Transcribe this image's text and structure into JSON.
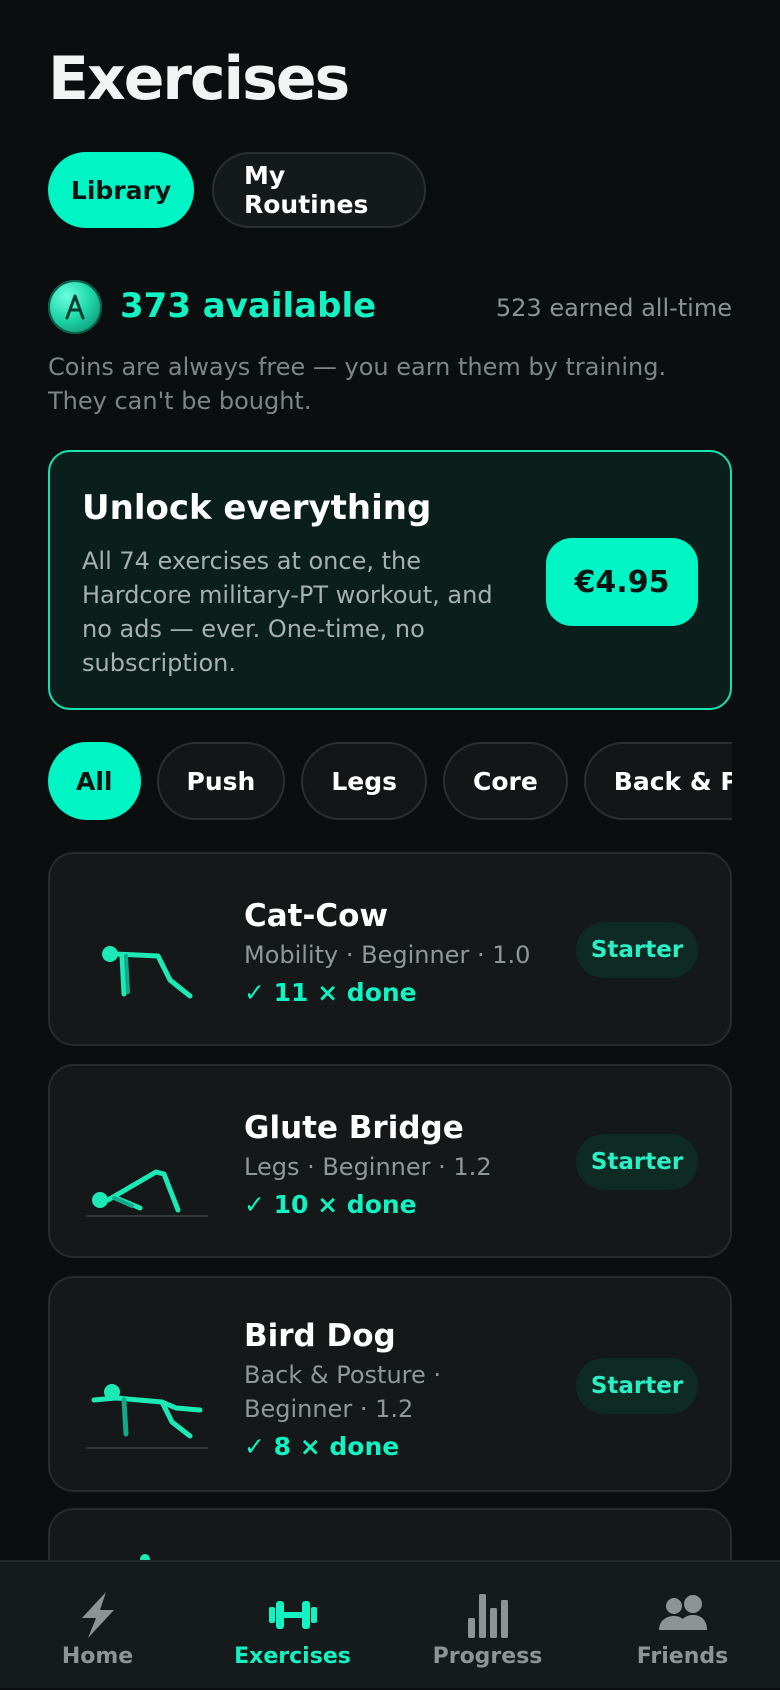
{
  "header": {
    "title": "Exercises"
  },
  "segments": {
    "library": "Library",
    "routines": "My Routines"
  },
  "coins": {
    "available": "373 available",
    "earned": "523 earned all-time",
    "note": "Coins are always free — you earn them by training. They can't be bought."
  },
  "unlock": {
    "title": "Unlock everything",
    "description": "All 74 exercises at once, the Hardcore military-PT workout, and no ads — ever. One-time, no subscription.",
    "price": "€4.95"
  },
  "filters": [
    "All",
    "Push",
    "Legs",
    "Core",
    "Back & Posture"
  ],
  "exercises": [
    {
      "name": "Cat-Cow",
      "meta": "Mobility · Beginner · 1.0",
      "done": "✓ 11 × done",
      "badge": "Starter"
    },
    {
      "name": "Glute Bridge",
      "meta": "Legs · Beginner · 1.2",
      "done": "✓ 10 × done",
      "badge": "Starter"
    },
    {
      "name": "Bird Dog",
      "meta": "Back & Posture · Beginner · 1.2",
      "done": "✓ 8 × done",
      "badge": "Starter"
    }
  ],
  "nav": {
    "home": "Home",
    "exercises": "Exercises",
    "progress": "Progress",
    "friends": "Friends"
  },
  "colors": {
    "accent": "#00f5c4",
    "background": "#0a0e0f",
    "card": "#141818"
  },
  "icons": {
    "coin": "coin-icon",
    "home": "lightning-icon",
    "exercises": "dumbbell-icon",
    "progress": "bar-chart-icon",
    "friends": "people-icon"
  }
}
